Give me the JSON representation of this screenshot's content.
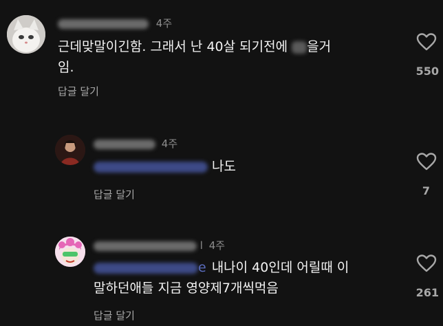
{
  "comments": [
    {
      "time": "4주",
      "text_line1_a": "근데맞말이긴함. 그래서 난 40살 되기전에 ",
      "text_line1_b": "을거",
      "text_line2": "임.",
      "reply_label": "답글 달기",
      "like_count": "550",
      "icon": "heart-outline-icon"
    },
    {
      "time": "4주",
      "text": "나도",
      "reply_label": "답글 달기",
      "like_count": "7",
      "icon": "heart-outline-icon"
    },
    {
      "time": "4주",
      "username_tail": "l",
      "mention_tail": "e",
      "text_line1": "내나이 40인데 어릴때 이",
      "text_line2": "말하던애들 지금 영양제7개씩먹음",
      "reply_label": "답글 달기",
      "like_count": "261",
      "icon": "heart-outline-icon"
    }
  ],
  "colors": {
    "background": "#121212",
    "secondary_text": "#a8a8a8",
    "mention": "#3d4a86"
  }
}
